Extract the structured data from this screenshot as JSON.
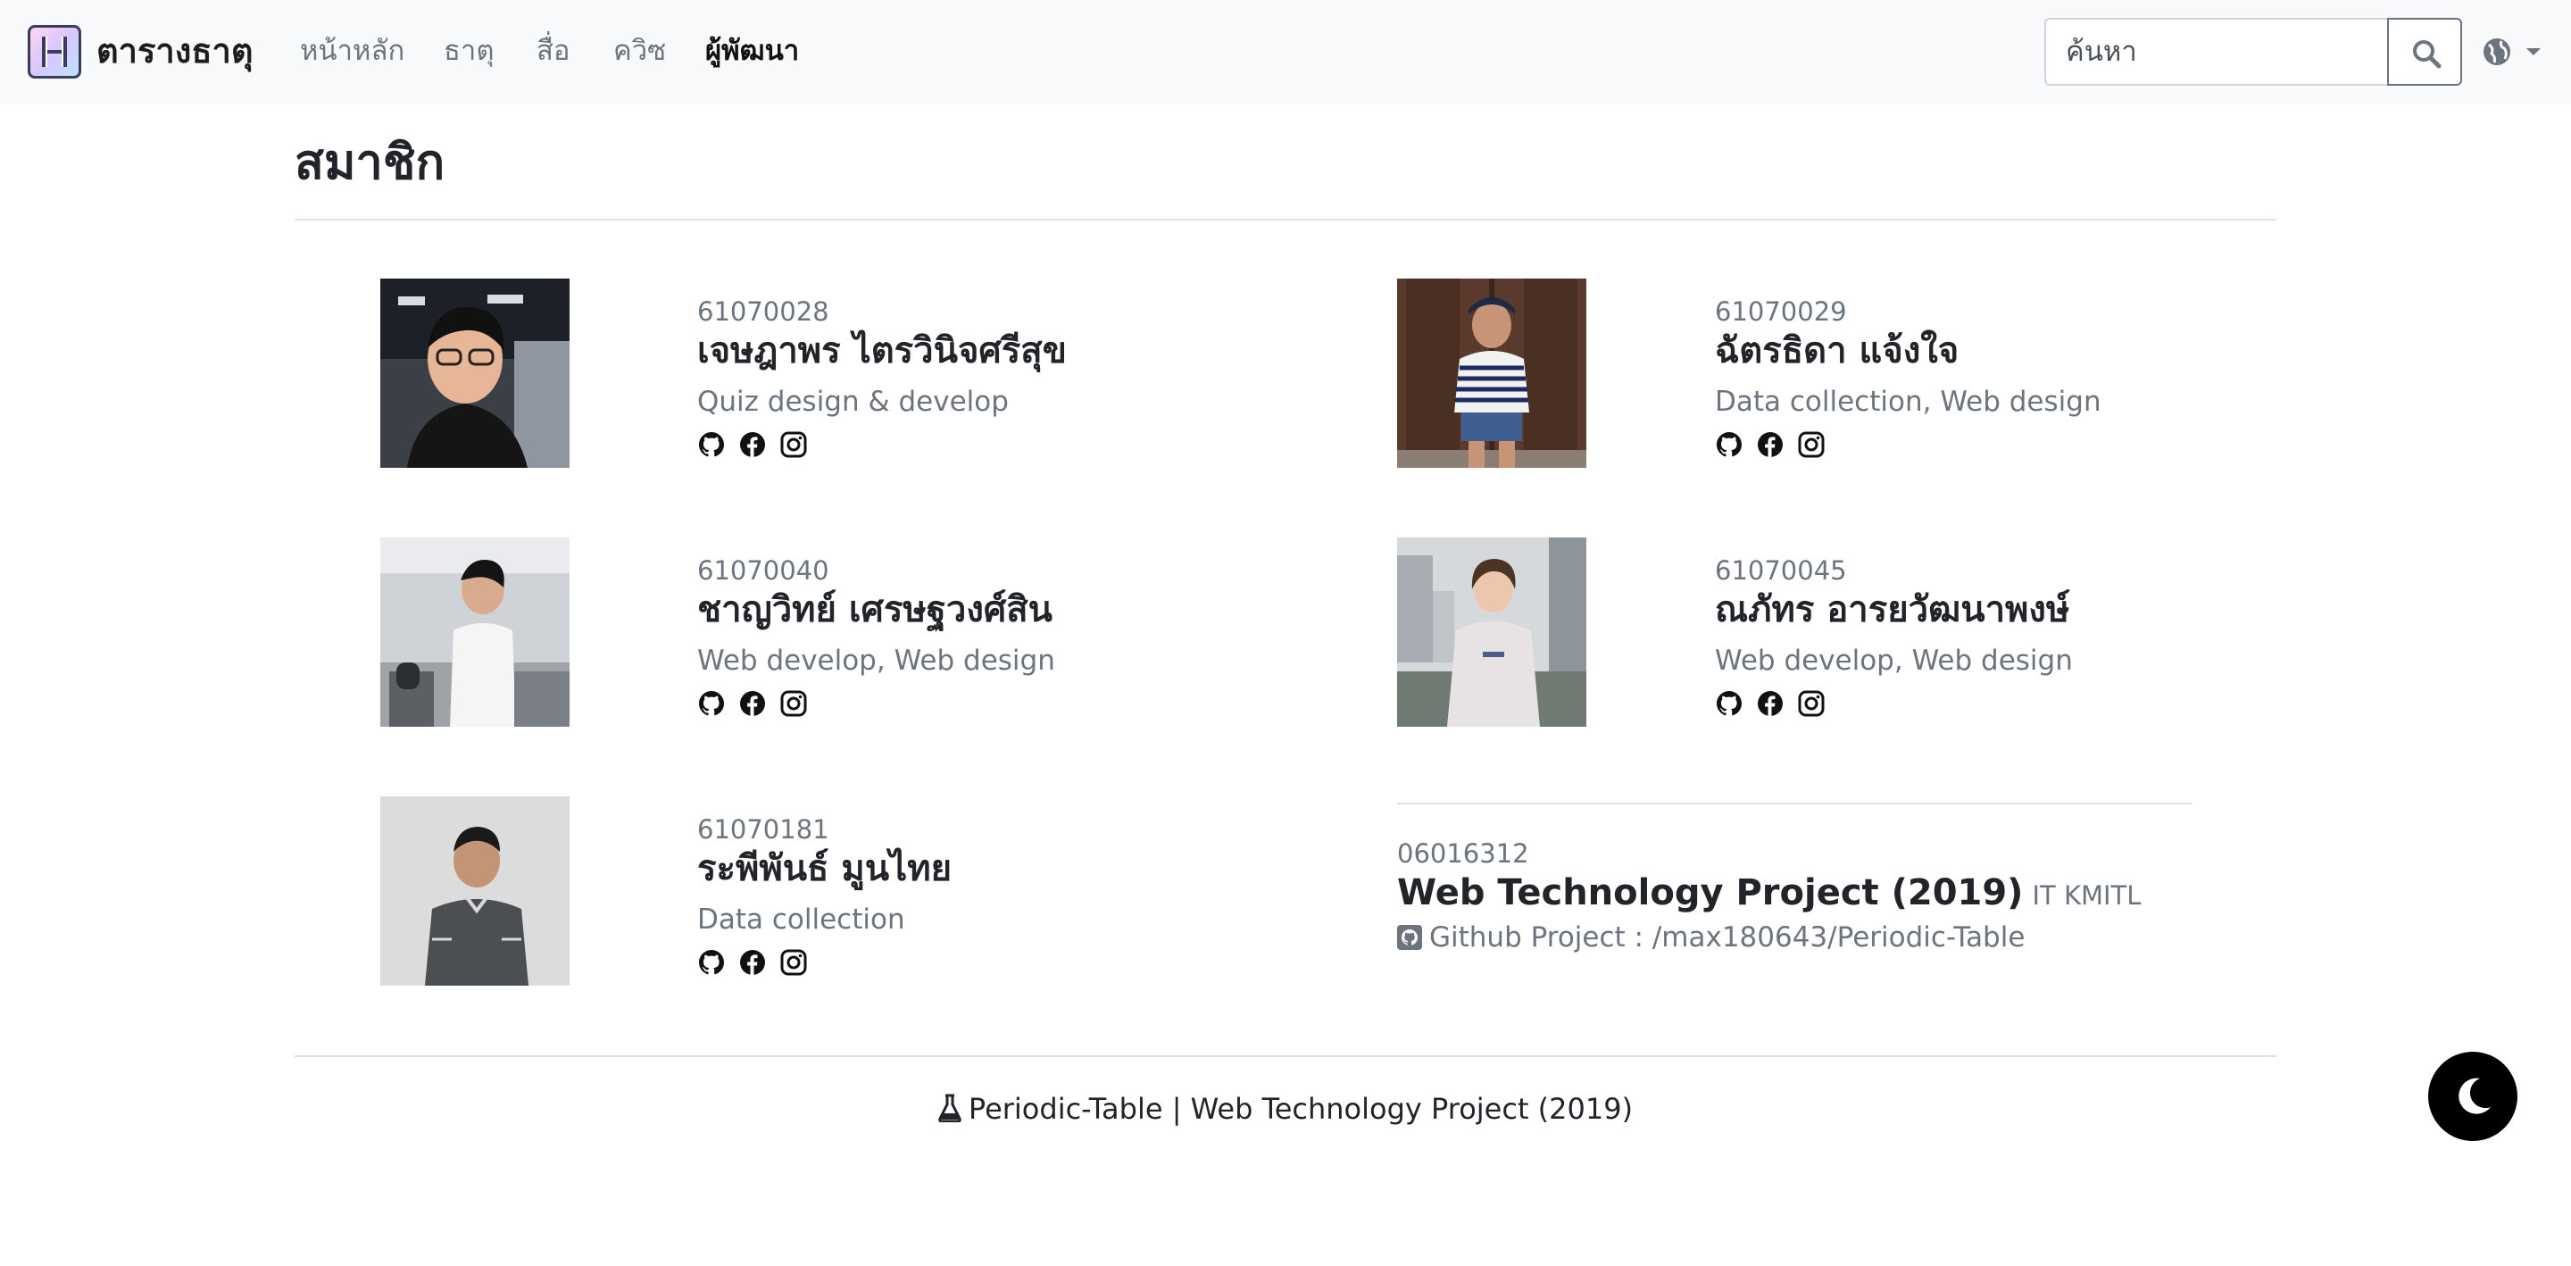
{
  "navbar": {
    "brand": "ตารางธาตุ",
    "links": [
      "หน้าหลัก",
      "ธาตุ",
      "สื่อ",
      "ควิซ",
      "ผู้พัฒนา"
    ],
    "active_link": "ผู้พัฒนา",
    "search_placeholder": "ค้นหา"
  },
  "page": {
    "title": "สมาชิก"
  },
  "members": [
    {
      "id": "61070028",
      "name": "เจษฎาพร ไตรวินิจศรีสุข",
      "role": "Quiz design & develop"
    },
    {
      "id": "61070029",
      "name": "ฉัตรธิดา แจ้งใจ",
      "role": "Data collection, Web design"
    },
    {
      "id": "61070040",
      "name": "ชาญวิทย์ เศรษฐวงศ์สิน",
      "role": "Web develop, Web design"
    },
    {
      "id": "61070045",
      "name": "ณภัทร อารยวัฒนาพงษ์",
      "role": "Web develop, Web design"
    },
    {
      "id": "61070181",
      "name": "ระพีพันธ์ มูนไทย",
      "role": "Data collection"
    }
  ],
  "project": {
    "code": "06016312",
    "title": "Web Technology Project (2019)",
    "org": "IT KMITL",
    "github_text": "Github Project : /max180643/Periodic-Table"
  },
  "footer": {
    "text": "Periodic-Table | Web Technology Project (2019)"
  },
  "colors": {
    "navbar_bg": "#f8f9fa",
    "muted": "#6c757d",
    "text": "#212529",
    "divider": "#dee2e6"
  },
  "icons": [
    "search-icon",
    "globe-icon",
    "github-icon",
    "facebook-icon",
    "instagram-icon",
    "flask-icon",
    "moon-icon"
  ]
}
